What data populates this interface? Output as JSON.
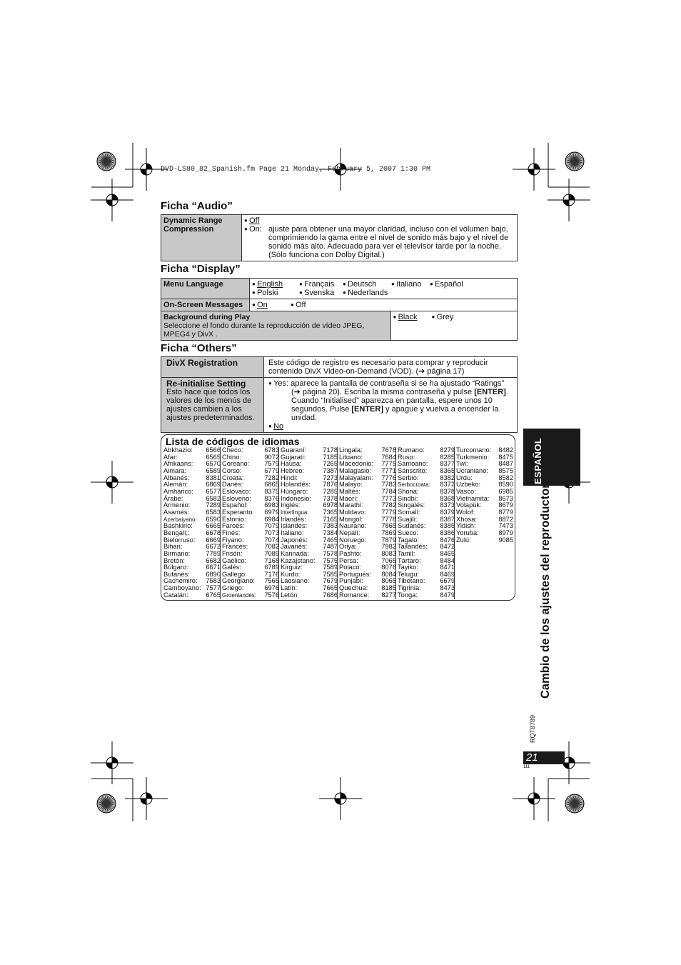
{
  "header": {
    "file_info": "DVD-LS80_82_Spanish.fm  Page 21  Monday, February 5, 2007  1:30 PM"
  },
  "audio": {
    "title": "Ficha “Audio”",
    "setting": "Dynamic Range Compression",
    "off": "Off",
    "on_label": "On:",
    "on_desc": "ajuste para obtener una mayor claridad, incluso con el volumen bajo, comprimiendo la gama entre el nivel de sonido más bajo y el nivel de sonido más alto. Adecuado para ver el televisor tarde por la noche. (Sólo funciona con Dolby Digital.)"
  },
  "display": {
    "title": "Ficha “Display”",
    "menu_language": {
      "label": "Menu Language",
      "options": [
        "English",
        "Français",
        "Deutsch",
        "Italiano",
        "Español",
        "Polski",
        "Svenska",
        "Nederlands"
      ],
      "selected": "English"
    },
    "osm": {
      "label": "On-Screen Messages",
      "options": [
        "On",
        "Off"
      ],
      "selected": "On"
    },
    "background": {
      "label": "Background during Play",
      "desc": "Seleccione el fondo durante la reproducción de vídeo JPEG, MPEG4 y DivX .",
      "options": [
        "Black",
        "Grey"
      ],
      "selected": "Black"
    }
  },
  "others": {
    "title": "Ficha “Others”",
    "divx": {
      "label": "DivX Registration",
      "desc": "Este código de registro es necesario para comprar y reproducir contenido DivX Video-on-Demand (VOD). (➔ página 17)"
    },
    "reinit": {
      "label": "Re-initialise Setting",
      "desc": "Esto hace que todos los valores de los menús de ajustes cambien a los ajustes predeterminados.",
      "yes_a": "Yes: aparece la pantalla de contraseña si se ha ajustado “Ratings” (➔ página 20). Escriba la misma contraseña y pulse ",
      "enter1": "[ENTER]",
      "yes_b": ". Cuando “Initialised” aparezca en pantalla, espere unos 10 segundos. Pulse ",
      "enter2": "[ENTER]",
      "yes_c": " y apague y vuelva a encender la unidad.",
      "no": "No"
    }
  },
  "languages": {
    "title": "Lista de códigos de idiomas",
    "columns": [
      [
        [
          "Abkhazio:",
          "6566"
        ],
        [
          "Afar:",
          "6565"
        ],
        [
          "Afrikaans:",
          "6570"
        ],
        [
          "Aimara:",
          "6589"
        ],
        [
          "Albanés:",
          "8381"
        ],
        [
          "Alemán:",
          "6869"
        ],
        [
          "Amharico:",
          "6577"
        ],
        [
          "Árabe:",
          "6582"
        ],
        [
          "Armenio:",
          "7289"
        ],
        [
          "Asamés:",
          "6583"
        ],
        [
          "Azerbaiyano:",
          "6590"
        ],
        [
          "Bashkirio:",
          "6665"
        ],
        [
          "Bengalí;:",
          "6678"
        ],
        [
          "Bielorruso:",
          "6669"
        ],
        [
          "Bihari:",
          "6672"
        ],
        [
          "Birmano:",
          "7789"
        ],
        [
          "Bretón:",
          "6682"
        ],
        [
          "Búlgaro:",
          "6671"
        ],
        [
          "Butanés:",
          "6890"
        ],
        [
          "Cachemiro:",
          "7583"
        ],
        [
          "Camboyano:",
          "7577"
        ],
        [
          "Catalán:",
          "6765"
        ]
      ],
      [
        [
          "Checo:",
          "6783"
        ],
        [
          "Chino:",
          "9072"
        ],
        [
          "Coreano:",
          "7579"
        ],
        [
          "Corso:",
          "6779"
        ],
        [
          "Croata:",
          "7282"
        ],
        [
          "Danés:",
          "6865"
        ],
        [
          "Eslovaco:",
          "8375"
        ],
        [
          "Esloveno:",
          "8376"
        ],
        [
          "Español:",
          "6983"
        ],
        [
          "Esperanto:",
          "6979"
        ],
        [
          "Estonio:",
          "6984"
        ],
        [
          "Faroés:",
          "7079"
        ],
        [
          "Finés:",
          "7073"
        ],
        [
          "Fiyano:",
          "7074"
        ],
        [
          "Francés:",
          "7082"
        ],
        [
          "Frisón:",
          "7089"
        ],
        [
          "Gaélico:",
          "7168"
        ],
        [
          "Galés:",
          "6789"
        ],
        [
          "Gallego:",
          "7176"
        ],
        [
          "Georgiano:",
          "7565"
        ],
        [
          "Griego:",
          "6976"
        ],
        [
          "Groenlandés:",
          "7576"
        ]
      ],
      [
        [
          "Guaraní:",
          "7178"
        ],
        [
          "Gujarati:",
          "7185"
        ],
        [
          "Hausa:",
          "7265"
        ],
        [
          "Hebreo:",
          "7387"
        ],
        [
          "Hindi:",
          "7273"
        ],
        [
          "Holandés:",
          "7876"
        ],
        [
          "Húngaro:",
          "7285"
        ],
        [
          "Indonesio:",
          "7378"
        ],
        [
          "Inglés:",
          "6978"
        ],
        [
          "Interlingua:",
          "7365"
        ],
        [
          "Irlandés:",
          "7165"
        ],
        [
          "Islandés:",
          "7383"
        ],
        [
          "Italiano:",
          "7384"
        ],
        [
          "Japonés:",
          "7465"
        ],
        [
          "Javanés:",
          "7487"
        ],
        [
          "Kannada:",
          "7578"
        ],
        [
          "Kazajstano:",
          "7575"
        ],
        [
          "Kirguiz:",
          "7589"
        ],
        [
          "Kurdo:",
          "7585"
        ],
        [
          "Laosiano:",
          "7679"
        ],
        [
          "Latín:",
          "7665"
        ],
        [
          "Letón",
          "7686"
        ]
      ],
      [
        [
          "Lingala:",
          "7678"
        ],
        [
          "Lituano:",
          "7684"
        ],
        [
          "Macedonio:",
          "7775"
        ],
        [
          "Malagasio:",
          "7771"
        ],
        [
          "Malayalam:",
          "7776"
        ],
        [
          "Malayo:",
          "7783"
        ],
        [
          "Maltés:",
          "7784"
        ],
        [
          "Maorí:",
          "7773"
        ],
        [
          "Marathí:",
          "7782"
        ],
        [
          "Moldavo:",
          "7779"
        ],
        [
          "Mongol:",
          "7778"
        ],
        [
          "Naurano:",
          "7865"
        ],
        [
          "Nepalí:",
          "7869"
        ],
        [
          "Noruego:",
          "7879"
        ],
        [
          "Oriya:",
          "7982"
        ],
        [
          "Pashto:",
          "8083"
        ],
        [
          "Persa:",
          "7065"
        ],
        [
          "Polaco:",
          "8076"
        ],
        [
          "Portugués:",
          "8084"
        ],
        [
          "Punjabi:",
          "8065"
        ],
        [
          "Quechua:",
          "8185"
        ],
        [
          "Romance:",
          "8277"
        ]
      ],
      [
        [
          "Rumano:",
          "8279"
        ],
        [
          "Ruso:",
          "8285"
        ],
        [
          "Samoano:",
          "8377"
        ],
        [
          "Sánscrito:",
          "8365"
        ],
        [
          "Serbio:",
          "8382"
        ],
        [
          "Serbocroata:",
          "8372"
        ],
        [
          "Shona:",
          "8378"
        ],
        [
          "Sindhi:",
          "8368"
        ],
        [
          "Singalés:",
          "8373"
        ],
        [
          "Somalí:",
          "8379"
        ],
        [
          "Suajili:",
          "8387"
        ],
        [
          "Sudanés:",
          "8385"
        ],
        [
          "Sueco:",
          "8386"
        ],
        [
          "Tagalo:",
          "8476"
        ],
        [
          "Tailandés:",
          "8472"
        ],
        [
          "Tamil:",
          "8465"
        ],
        [
          "Tártaro:",
          "8484"
        ],
        [
          "Tayiko:",
          "8471"
        ],
        [
          "Telugu:",
          "8469"
        ],
        [
          "Tibetano:",
          "6679"
        ],
        [
          "Tigrinia:",
          "8473"
        ],
        [
          "Tonga:",
          "8479"
        ]
      ],
      [
        [
          "Turcomano:",
          "8482"
        ],
        [
          "Turkmenio:",
          "8475"
        ],
        [
          "Twi:",
          "8487"
        ],
        [
          "Ucraniano:",
          "8575"
        ],
        [
          "Urdu:",
          "8582"
        ],
        [
          "Uzbeko:",
          "8590"
        ],
        [
          "Vasco:",
          "6985"
        ],
        [
          "Vietnamita:",
          "8673"
        ],
        [
          "Volapük:",
          "8679"
        ],
        [
          "Wolof:",
          "8779"
        ],
        [
          "Xhosa:",
          "8872"
        ],
        [
          "Yidish:",
          "7473"
        ],
        [
          "Yoruba:",
          "8979"
        ],
        [
          "Zulú:",
          "9085"
        ]
      ]
    ]
  },
  "side": {
    "tab": "ESPAÑOL",
    "title": "Cambio de los ajustes del reproductor",
    "code": "RQT8789",
    "page": "21",
    "sub": "111"
  }
}
